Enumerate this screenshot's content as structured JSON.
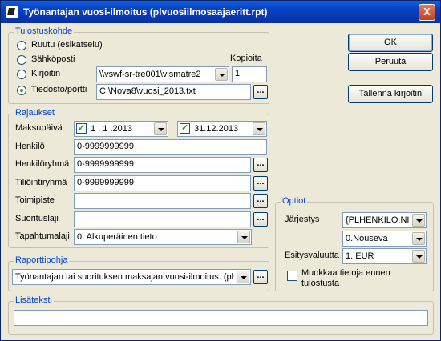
{
  "window": {
    "title": "Työnantajan vuosi-ilmoitus (plvuosiilmosaajaeritt.rpt)",
    "close_label": "X"
  },
  "buttons": {
    "ok": "OK",
    "cancel": "Peruuta",
    "save_printer": "Tallenna kirjoitin"
  },
  "tulostuskohde": {
    "legend": "Tulostuskohde",
    "options": [
      "Ruutu (esikatselu)",
      "Sähköposti",
      "Kirjoitin",
      "Tiedosto/portti"
    ],
    "selected": "Tiedosto/portti",
    "printer_value": "\\\\vswf-sr-tre001\\vismatre2",
    "copies_label": "Kopioita",
    "copies_value": "1",
    "file_value": "C:\\Nova8\\vuosi_2013.txt"
  },
  "rajaukset": {
    "legend": "Rajaukset",
    "maksupaiva_label": "Maksupäivä",
    "date_from": "1 . 1 .2013",
    "date_to": "31.12.2013",
    "henkilo_label": "Henkilö",
    "henkilo_value": "0-9999999999",
    "henkiloryhma_label": "Henkilöryhmä",
    "henkiloryhma_value": "0-9999999999",
    "tiliointiryhma_label": "Tiliöintiryhmä",
    "tiliointiryhma_value": "0-9999999999",
    "toimipiste_label": "Toimipiste",
    "toimipiste_value": "",
    "suorituslaji_label": "Suorituslaji",
    "suorituslaji_value": "",
    "tapahtumalaji_label": "Tapahtumalaji",
    "tapahtumalaji_value": "0. Alkuperäinen tieto"
  },
  "raporttipohja": {
    "legend": "Raporttipohja",
    "value": "Työnantajan tai suorituksen maksajan vuosi-ilmoitus. (plvu"
  },
  "optiot": {
    "legend": "Optiot",
    "jarjestys_label": "Järjestys",
    "jarjestys_value": "{PLHENKILO.NIM",
    "suunta_value": "0.Nouseva",
    "esitysvaluutta_label": "Esitysvaluutta",
    "esitysvaluutta_value": "1. EUR",
    "muokkaa_label_line1": "Muokkaa tietoja ennen",
    "muokkaa_label_line2": "tulostusta"
  },
  "lisateksti": {
    "legend": "Lisäteksti",
    "value": ""
  },
  "colors": {
    "titlebar": "#0a3fc0",
    "legend": "#0046d5",
    "face": "#ece9d8"
  }
}
